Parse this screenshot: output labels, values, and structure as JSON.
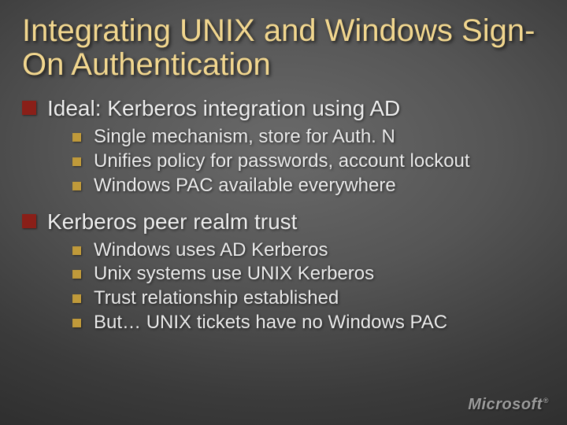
{
  "title": "Integrating UNIX and Windows Sign-On Authentication",
  "sections": [
    {
      "heading": "Ideal: Kerberos integration using AD",
      "items": [
        "Single mechanism, store for Auth. N",
        "Unifies policy for passwords, account lockout",
        "Windows PAC available everywhere"
      ]
    },
    {
      "heading": "Kerberos peer realm trust",
      "items": [
        "Windows uses AD Kerberos",
        "Unix systems use UNIX Kerberos",
        "Trust relationship established",
        "But… UNIX tickets have no Windows PAC"
      ]
    }
  ],
  "branding": "Microsoft"
}
